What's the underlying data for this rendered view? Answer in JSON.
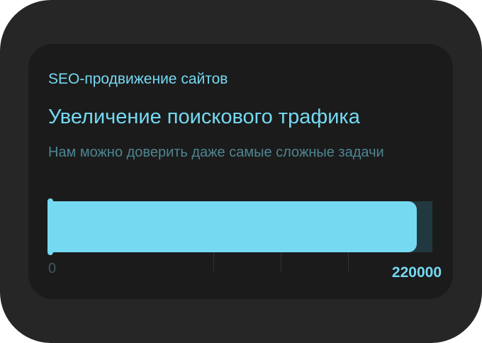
{
  "card": {
    "category": "SEO-продвижение сайтов",
    "title": "Увеличение поискового трафика",
    "subtitle": "Нам можно доверить даже самые сложные задачи"
  },
  "progress": {
    "min_label": "0",
    "max_label": "220000",
    "min": 0,
    "max": 220000,
    "fill_fraction": 0.96
  },
  "colors": {
    "accent": "#75d9f2",
    "muted_text": "#4d8591",
    "track": "#213840",
    "card_bg": "#1b1b1b",
    "outer_bg": "#262626"
  }
}
